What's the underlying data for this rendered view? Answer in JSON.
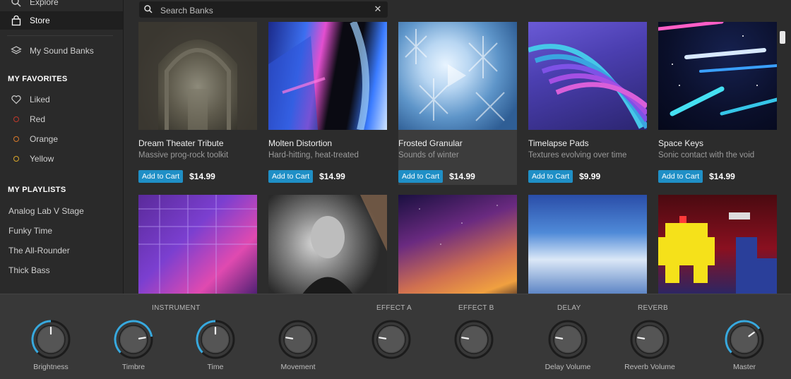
{
  "sidebar": {
    "explore": "Explore",
    "store": "Store",
    "my_sound_banks": "My Sound Banks",
    "favorites_heading": "MY FAVORITES",
    "favorites": [
      {
        "label": "Liked",
        "icon": "heart-icon"
      },
      {
        "label": "Red",
        "color": "#c0392b"
      },
      {
        "label": "Orange",
        "color": "#d8792a"
      },
      {
        "label": "Yellow",
        "color": "#d9a72b"
      }
    ],
    "playlists_heading": "MY PLAYLISTS",
    "playlists": [
      "Analog Lab V Stage",
      "Funky Time",
      "The All-Rounder",
      "Thick Bass"
    ]
  },
  "search": {
    "placeholder": "Search Banks"
  },
  "cart_label": "Add to Cart",
  "banks": [
    {
      "title": "Dream Theater Tribute",
      "subtitle": "Massive prog-rock toolkit",
      "price": "$14.99"
    },
    {
      "title": "Molten Distortion",
      "subtitle": "Hard-hitting, heat-treated",
      "price": "$14.99"
    },
    {
      "title": "Frosted Granular",
      "subtitle": "Sounds of winter",
      "price": "$14.99"
    },
    {
      "title": "Timelapse Pads",
      "subtitle": "Textures evolving over time",
      "price": "$9.99"
    },
    {
      "title": "Space Keys",
      "subtitle": "Sonic contact with the void",
      "price": "$14.99"
    }
  ],
  "controls": {
    "sections": {
      "instrument": "INSTRUMENT",
      "effect_a": "EFFECT A",
      "effect_b": "EFFECT B",
      "delay": "DELAY",
      "reverb": "REVERB"
    },
    "knobs": [
      {
        "label": "Brightness",
        "value": 0.5,
        "accent": true
      },
      {
        "label": "Timbre",
        "value": 0.8,
        "accent": true
      },
      {
        "label": "Time",
        "value": 0.5,
        "accent": true
      },
      {
        "label": "Movement",
        "value": 0.2,
        "accent": false
      },
      {
        "label": "",
        "value": 0.2,
        "accent": false
      },
      {
        "label": "",
        "value": 0.2,
        "accent": false
      },
      {
        "label": "Delay Volume",
        "value": 0.2,
        "accent": false
      },
      {
        "label": "Reverb Volume",
        "value": 0.2,
        "accent": false
      },
      {
        "label": "Master",
        "value": 0.7,
        "accent": true
      }
    ]
  },
  "colors": {
    "accent": "#1f8fc6",
    "knob_ring": "#38a9de"
  }
}
